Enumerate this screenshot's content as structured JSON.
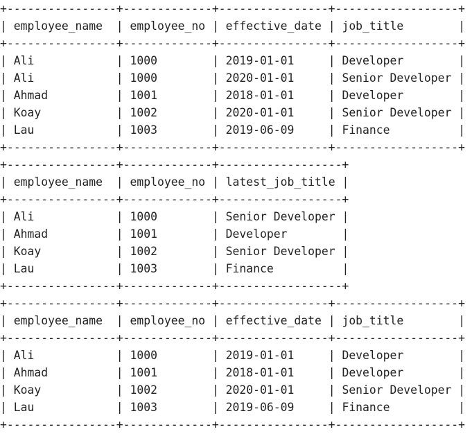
{
  "tables": [
    {
      "name": "employee-jobs-table",
      "widths": [
        16,
        13,
        16,
        18
      ],
      "columns": [
        "employee_name",
        "employee_no",
        "effective_date",
        "job_title"
      ],
      "rows": [
        [
          "Ali",
          "1000",
          "2019-01-01",
          "Developer"
        ],
        [
          "Ali",
          "1000",
          "2020-01-01",
          "Senior Developer"
        ],
        [
          "Ahmad",
          "1001",
          "2018-01-01",
          "Developer"
        ],
        [
          "Koay",
          "1002",
          "2020-01-01",
          "Senior Developer"
        ],
        [
          "Lau",
          "1003",
          "2019-06-09",
          "Finance"
        ]
      ]
    },
    {
      "name": "latest-job-title-table",
      "widths": [
        16,
        13,
        18
      ],
      "columns": [
        "employee_name",
        "employee_no",
        "latest_job_title"
      ],
      "rows": [
        [
          "Ali",
          "1000",
          "Senior Developer"
        ],
        [
          "Ahmad",
          "1001",
          "Developer"
        ],
        [
          "Koay",
          "1002",
          "Senior Developer"
        ],
        [
          "Lau",
          "1003",
          "Finance"
        ]
      ]
    },
    {
      "name": "employee-latest-jobs-table",
      "widths": [
        16,
        13,
        16,
        18
      ],
      "columns": [
        "employee_name",
        "employee_no",
        "effective_date",
        "job_title"
      ],
      "rows": [
        [
          "Ali",
          "1000",
          "2019-01-01",
          "Developer"
        ],
        [
          "Ahmad",
          "1001",
          "2018-01-01",
          "Developer"
        ],
        [
          "Koay",
          "1002",
          "2020-01-01",
          "Senior Developer"
        ],
        [
          "Lau",
          "1003",
          "2019-06-09",
          "Finance"
        ]
      ]
    }
  ]
}
